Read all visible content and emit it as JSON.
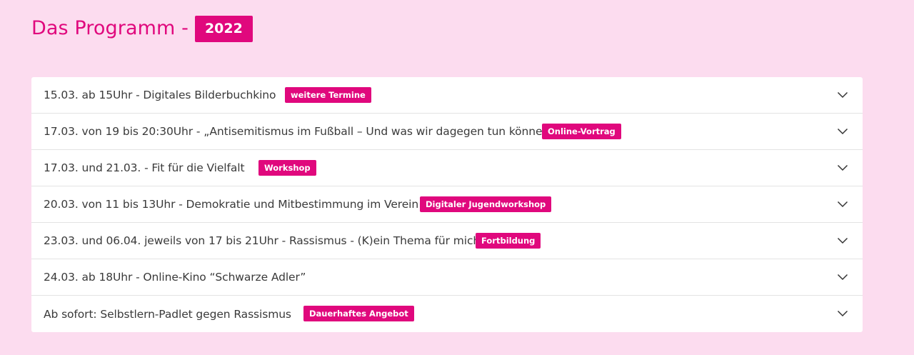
{
  "header": {
    "title": "Das Programm -",
    "year": "2022"
  },
  "accordion": {
    "items": [
      {
        "title": "15.03. ab 15Uhr - Digitales Bilderbuchkino",
        "tag": "weitere Termine"
      },
      {
        "title": "17.03. von 19 bis 20:30Uhr - „Antisemitismus im Fußball – Und was wir dagegen tun können”",
        "tag": "Online-Vortrag"
      },
      {
        "title": "17.03. und 21.03. - Fit für die Vielfalt",
        "tag": "Workshop"
      },
      {
        "title": "20.03. von 11 bis 13Uhr - Demokratie und Mitbestimmung im Verein",
        "tag": "Digitaler Jugendworkshop"
      },
      {
        "title": "23.03. und 06.04. jeweils von 17 bis 21Uhr - Rassismus - (K)ein Thema für mich?",
        "tag": "Fortbildung"
      },
      {
        "title": "24.03. ab 18Uhr - Online-Kino “Schwarze Adler”",
        "tag": ""
      },
      {
        "title": "Ab sofort: Selbstlern-Padlet gegen Rassismus",
        "tag": "Dauerhaftes Angebot"
      }
    ],
    "expand_icon": "chevron-down-icon"
  },
  "colors": {
    "background": "#fcdcef",
    "accent": "#e0087d",
    "panel": "#ffffff",
    "text": "#3a3a3a"
  }
}
